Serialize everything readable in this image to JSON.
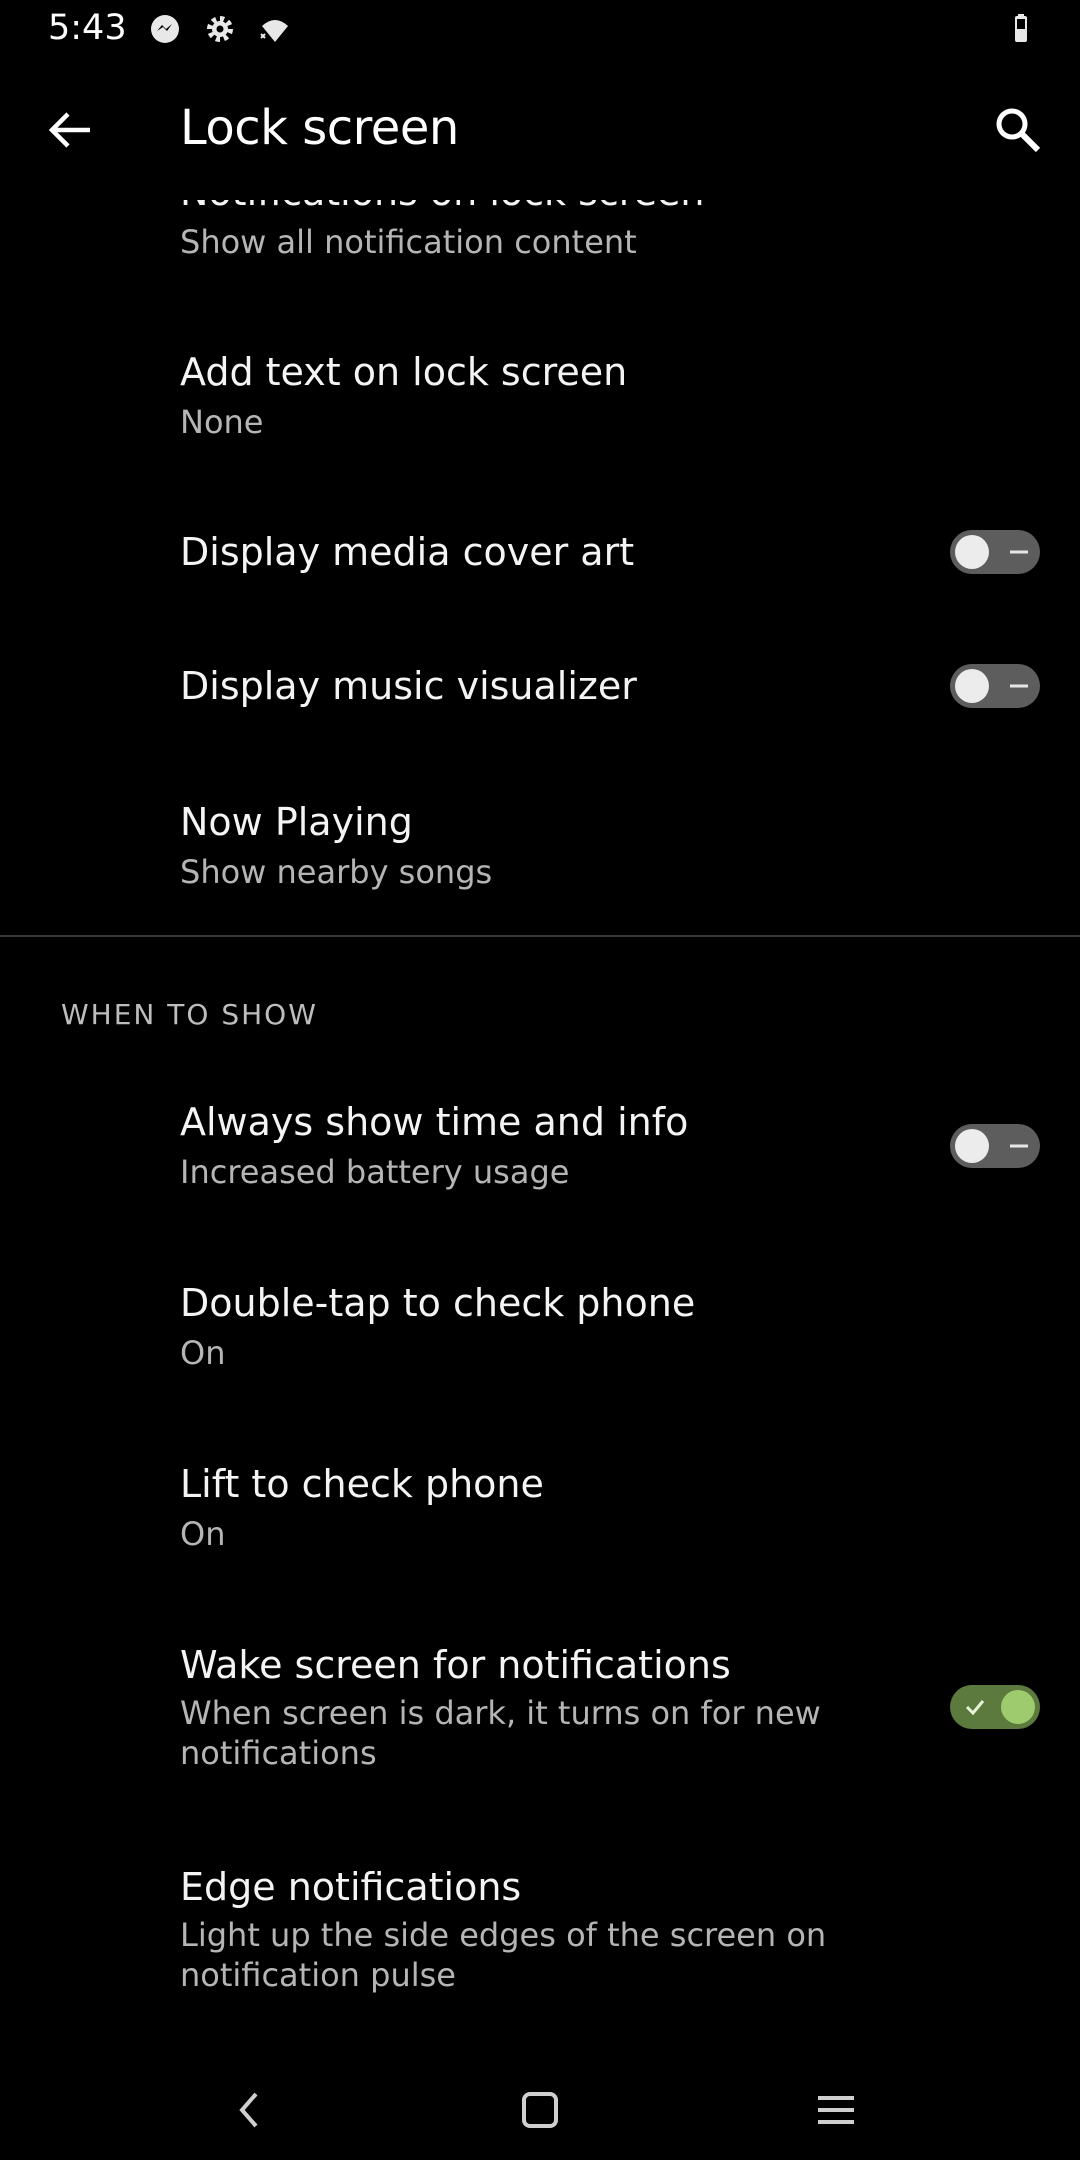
{
  "status_bar": {
    "time": "5:43",
    "icons": [
      "messenger-icon",
      "settings-icon",
      "wifi-icon",
      "battery-icon"
    ]
  },
  "app_bar": {
    "title": "Lock screen",
    "back_icon": "back-arrow-icon",
    "search_icon": "search-icon"
  },
  "items": [
    {
      "title": "Notifications on lock screen",
      "subtitle": "Show all notification content"
    },
    {
      "title": "Add text on lock screen",
      "subtitle": "None"
    },
    {
      "title": "Display media cover art",
      "toggle": "off"
    },
    {
      "title": "Display music visualizer",
      "toggle": "off"
    },
    {
      "title": "Now Playing",
      "subtitle": "Show nearby songs"
    }
  ],
  "section_when_to_show": {
    "header": "WHEN TO SHOW",
    "items": [
      {
        "title": "Always show time and info",
        "subtitle": "Increased battery usage",
        "toggle": "off"
      },
      {
        "title": "Double-tap to check phone",
        "subtitle": "On"
      },
      {
        "title": "Lift to check phone",
        "subtitle": "On"
      },
      {
        "title": "Wake screen for notifications",
        "subtitle": "When screen is dark, it turns on for new notifications",
        "toggle": "on"
      },
      {
        "title": "Edge notifications",
        "subtitle": "Light up the side edges of the screen on notification pulse"
      }
    ]
  },
  "nav_bar": {
    "icons": [
      "nav-back-icon",
      "nav-home-icon",
      "nav-recents-icon"
    ]
  },
  "colors": {
    "background": "#000000",
    "toggle_on_track": "#5c7a3e",
    "toggle_on_knob": "#9ecb6e",
    "toggle_off_track": "#5d5d5d"
  }
}
